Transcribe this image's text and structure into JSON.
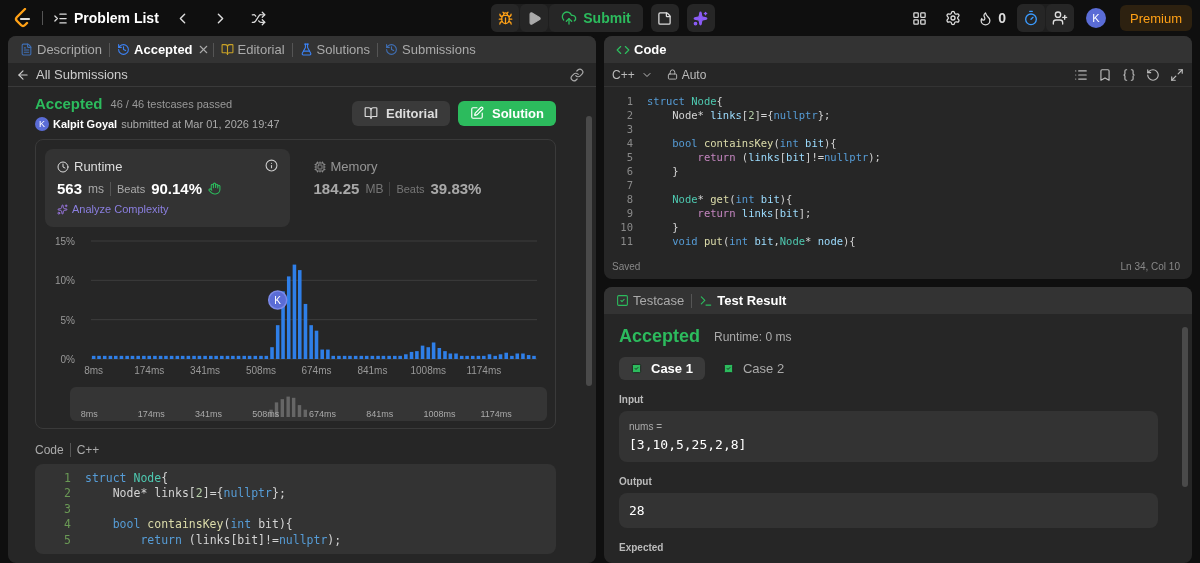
{
  "nav": {
    "title": "Problem List",
    "submit": "Submit",
    "streak": "0",
    "timer_on": true,
    "avatar": "K",
    "premium": "Premium"
  },
  "left_tabs": [
    {
      "label": "Description",
      "selected": false,
      "closable": false
    },
    {
      "label": "Accepted",
      "selected": true,
      "closable": true
    },
    {
      "label": "Editorial",
      "selected": false,
      "closable": false
    },
    {
      "label": "Solutions",
      "selected": false,
      "closable": false
    },
    {
      "label": "Submissions",
      "selected": false,
      "closable": false
    }
  ],
  "submission": {
    "back": "All Submissions",
    "status": "Accepted",
    "testcases": "46 / 46 testcases passed",
    "avatar": "K",
    "user": "Kalpit Goyal",
    "submitted": "submitted at Mar 01, 2026 19:47",
    "buttons": [
      {
        "label": "Editorial",
        "kind": "secondary"
      },
      {
        "label": "Solution",
        "kind": "primary"
      }
    ]
  },
  "stats": [
    {
      "kind": "runtime",
      "title": "Runtime",
      "selected": true,
      "value": "563",
      "unit": "ms",
      "beats_label": "Beats",
      "beats": "90.14%",
      "link": "Analyze Complexity"
    },
    {
      "kind": "memory",
      "title": "Memory",
      "selected": false,
      "value": "184.25",
      "unit": "MB",
      "beats_label": "Beats",
      "beats": "39.83%"
    }
  ],
  "chart_data": {
    "type": "bar",
    "xlim": [
      0,
      1333
    ],
    "ylim": [
      0,
      15
    ],
    "yticks": [
      {
        "value": 0,
        "label": "0%"
      },
      {
        "value": 5,
        "label": "5%"
      },
      {
        "value": 10,
        "label": "10%"
      },
      {
        "value": 15,
        "label": "15%"
      }
    ],
    "xticks": [
      {
        "value": 8,
        "label": "8ms"
      },
      {
        "value": 174,
        "label": "174ms"
      },
      {
        "value": 341,
        "label": "341ms"
      },
      {
        "value": 508,
        "label": "508ms"
      },
      {
        "value": 674,
        "label": "674ms"
      },
      {
        "value": 841,
        "label": "841ms"
      },
      {
        "value": 1008,
        "label": "1008ms"
      },
      {
        "value": 1174,
        "label": "1174ms"
      }
    ],
    "x": [
      8,
      24,
      41,
      58,
      74,
      91,
      108,
      124,
      141,
      158,
      174,
      191,
      208,
      224,
      241,
      258,
      274,
      291,
      308,
      324,
      341,
      358,
      374,
      391,
      408,
      424,
      441,
      458,
      474,
      491,
      508,
      524,
      541,
      558,
      574,
      591,
      608,
      624,
      641,
      658,
      674,
      691,
      708,
      724,
      741,
      758,
      774,
      791,
      808,
      824,
      841,
      858,
      874,
      891,
      908,
      924,
      941,
      958,
      974,
      991,
      1008,
      1024,
      1041,
      1058,
      1074,
      1091,
      1108,
      1124,
      1141,
      1158,
      1174,
      1191,
      1208,
      1224,
      1241,
      1258,
      1274,
      1291,
      1308,
      1324
    ],
    "series": [
      {
        "color": "#2f7fe8",
        "values": [
          0.4,
          0.4,
          0.4,
          0.4,
          0.4,
          0.4,
          0.4,
          0.4,
          0.4,
          0.4,
          0.4,
          0.4,
          0.4,
          0.4,
          0.4,
          0.4,
          0.4,
          0.4,
          0.4,
          0.4,
          0.4,
          0.4,
          0.4,
          0.4,
          0.4,
          0.4,
          0.4,
          0.4,
          0.4,
          0.4,
          0.4,
          0.4,
          1.5,
          4.3,
          8.6,
          10.5,
          12,
          11.3,
          7,
          4.3,
          3.6,
          1.2,
          1.2,
          0.4,
          0.4,
          0.4,
          0.4,
          0.4,
          0.4,
          0.4,
          0.4,
          0.4,
          0.4,
          0.4,
          0.4,
          0.4,
          0.6,
          0.9,
          1,
          1.7,
          1.5,
          2.1,
          1.4,
          1,
          0.7,
          0.7,
          0.4,
          0.4,
          0.4,
          0.4,
          0.4,
          0.6,
          0.4,
          0.6,
          0.8,
          0.4,
          0.7,
          0.7,
          0.5,
          0.4
        ]
      }
    ]
  },
  "chart_marker": {
    "avatar": "K"
  },
  "overview": {
    "labels": [
      "8ms",
      "174ms",
      "341ms",
      "508ms",
      "674ms",
      "841ms",
      "1008ms",
      "1174ms"
    ]
  },
  "code_section": {
    "label": "Code",
    "language": "C++",
    "lines": [
      {
        "number": "1",
        "tokens": [
          {
            "kind": "kw",
            "text": "struct "
          },
          {
            "kind": "type",
            "text": "Node"
          },
          {
            "kind": "p",
            "text": "{"
          }
        ]
      },
      {
        "number": "2",
        "tokens": [
          {
            "kind": "p",
            "text": "    Node* links["
          },
          {
            "kind": "num",
            "text": "2"
          },
          {
            "kind": "p",
            "text": "]={"
          },
          {
            "kind": "kw",
            "text": "nullptr"
          },
          {
            "kind": "p",
            "text": "};"
          }
        ]
      },
      {
        "number": "3"
      },
      {
        "number": "4",
        "tokens": [
          {
            "kind": "kw",
            "text": "    bool "
          },
          {
            "kind": "fn",
            "text": "containsKey"
          },
          {
            "kind": "p",
            "text": "("
          },
          {
            "kind": "kw",
            "text": "int"
          },
          {
            "kind": "p",
            "text": " bit){"
          }
        ]
      },
      {
        "number": "5",
        "tokens": [
          {
            "kind": "kw",
            "text": "        return "
          },
          {
            "kind": "p",
            "text": "(links[bit]!="
          },
          {
            "kind": "kw",
            "text": "nullptr"
          },
          {
            "kind": "p",
            "text": ");"
          }
        ]
      }
    ]
  },
  "editor": {
    "title": "Code",
    "language": "C++",
    "mode": "Auto",
    "lines": [
      {
        "number": "1",
        "tokens": [
          {
            "kind": "kw",
            "text": "struct "
          },
          {
            "kind": "type",
            "text": "Node"
          },
          {
            "kind": "p",
            "text": "{"
          }
        ]
      },
      {
        "number": "2",
        "tokens": [
          {
            "kind": "p",
            "text": "    Node* "
          },
          {
            "kind": "var",
            "text": "links"
          },
          {
            "kind": "p",
            "text": "["
          },
          {
            "kind": "num",
            "text": "2"
          },
          {
            "kind": "p",
            "text": "]={"
          },
          {
            "kind": "kw",
            "text": "nullptr"
          },
          {
            "kind": "p",
            "text": "};"
          }
        ]
      },
      {
        "number": "3"
      },
      {
        "number": "4",
        "tokens": [
          {
            "kind": "kw",
            "text": "    bool "
          },
          {
            "kind": "fn",
            "text": "containsKey"
          },
          {
            "kind": "p",
            "text": "("
          },
          {
            "kind": "kw",
            "text": "int "
          },
          {
            "kind": "var",
            "text": "bit"
          },
          {
            "kind": "p",
            "text": "){"
          }
        ]
      },
      {
        "number": "5",
        "tokens": [
          {
            "kind": "ctl",
            "text": "        return "
          },
          {
            "kind": "p",
            "text": "("
          },
          {
            "kind": "var",
            "text": "links"
          },
          {
            "kind": "p",
            "text": "["
          },
          {
            "kind": "var",
            "text": "bit"
          },
          {
            "kind": "p",
            "text": "]!="
          },
          {
            "kind": "kw",
            "text": "nullptr"
          },
          {
            "kind": "p",
            "text": ");"
          }
        ]
      },
      {
        "number": "6",
        "tokens": [
          {
            "kind": "p",
            "text": "    }"
          }
        ]
      },
      {
        "number": "7"
      },
      {
        "number": "8",
        "tokens": [
          {
            "kind": "type",
            "text": "    Node"
          },
          {
            "kind": "p",
            "text": "* "
          },
          {
            "kind": "fn",
            "text": "get"
          },
          {
            "kind": "p",
            "text": "("
          },
          {
            "kind": "kw",
            "text": "int "
          },
          {
            "kind": "var",
            "text": "bit"
          },
          {
            "kind": "p",
            "text": "){"
          }
        ]
      },
      {
        "number": "9",
        "tokens": [
          {
            "kind": "ctl",
            "text": "        return "
          },
          {
            "kind": "var",
            "text": "links"
          },
          {
            "kind": "p",
            "text": "["
          },
          {
            "kind": "var",
            "text": "bit"
          },
          {
            "kind": "p",
            "text": "];"
          }
        ]
      },
      {
        "number": "10",
        "tokens": [
          {
            "kind": "p",
            "text": "    }"
          }
        ]
      },
      {
        "number": "11",
        "tokens": [
          {
            "kind": "kw",
            "text": "    void "
          },
          {
            "kind": "fn",
            "text": "put"
          },
          {
            "kind": "p",
            "text": "("
          },
          {
            "kind": "kw",
            "text": "int "
          },
          {
            "kind": "var",
            "text": "bit"
          },
          {
            "kind": "p",
            "text": ","
          },
          {
            "kind": "type",
            "text": "Node"
          },
          {
            "kind": "p",
            "text": "* "
          },
          {
            "kind": "var",
            "text": "node"
          },
          {
            "kind": "p",
            "text": "){"
          }
        ]
      }
    ],
    "status": "Saved",
    "cursor": "Ln 34, Col 10"
  },
  "test": {
    "tabs": [
      {
        "label": "Testcase",
        "selected": false
      },
      {
        "label": "Test Result",
        "selected": true
      }
    ],
    "status": "Accepted",
    "runtime": "Runtime: 0 ms",
    "cases": [
      {
        "label": "Case 1",
        "selected": true,
        "passed": true
      },
      {
        "label": "Case 2",
        "selected": false,
        "passed": true
      }
    ],
    "input_label": "Input",
    "inputs": [
      {
        "name": "nums =",
        "value": "[3,10,5,25,2,8]"
      }
    ],
    "output_label": "Output",
    "output": "28",
    "expected_label": "Expected"
  }
}
